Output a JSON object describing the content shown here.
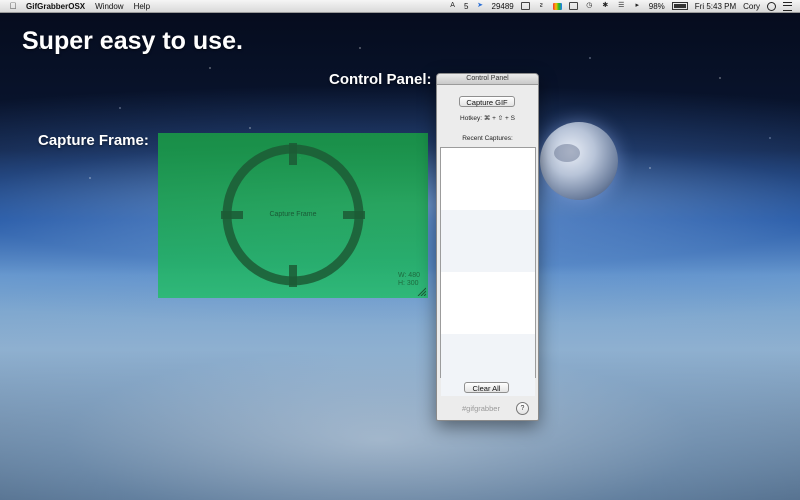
{
  "menubar": {
    "apple_icon": "apple-logo-icon",
    "app_name": "GifGrabberOSX",
    "menus": [
      "Window",
      "Help"
    ],
    "status": {
      "adobe_count": "5",
      "inbox_count": "29489",
      "battery_percent": "98%",
      "clock": "Fri 5:43 PM",
      "user": "Cory"
    }
  },
  "annotations": {
    "headline": "Super easy to use.",
    "control_panel_label": "Control Panel:",
    "capture_frame_label": "Capture Frame:"
  },
  "capture_frame": {
    "center_text": "Capture Frame",
    "width_text": "W: 480",
    "height_text": "H: 300",
    "color": "#1fae5a"
  },
  "control_panel": {
    "title": "Control Panel",
    "capture_button": "Capture GIF",
    "hotkey": "Hotkey: ⌘ + ⇧ + S",
    "recent_label": "Recent Captures:",
    "recent_items": [],
    "clear_button": "Clear All",
    "hashtag": "#gifgrabber",
    "help": "?"
  }
}
